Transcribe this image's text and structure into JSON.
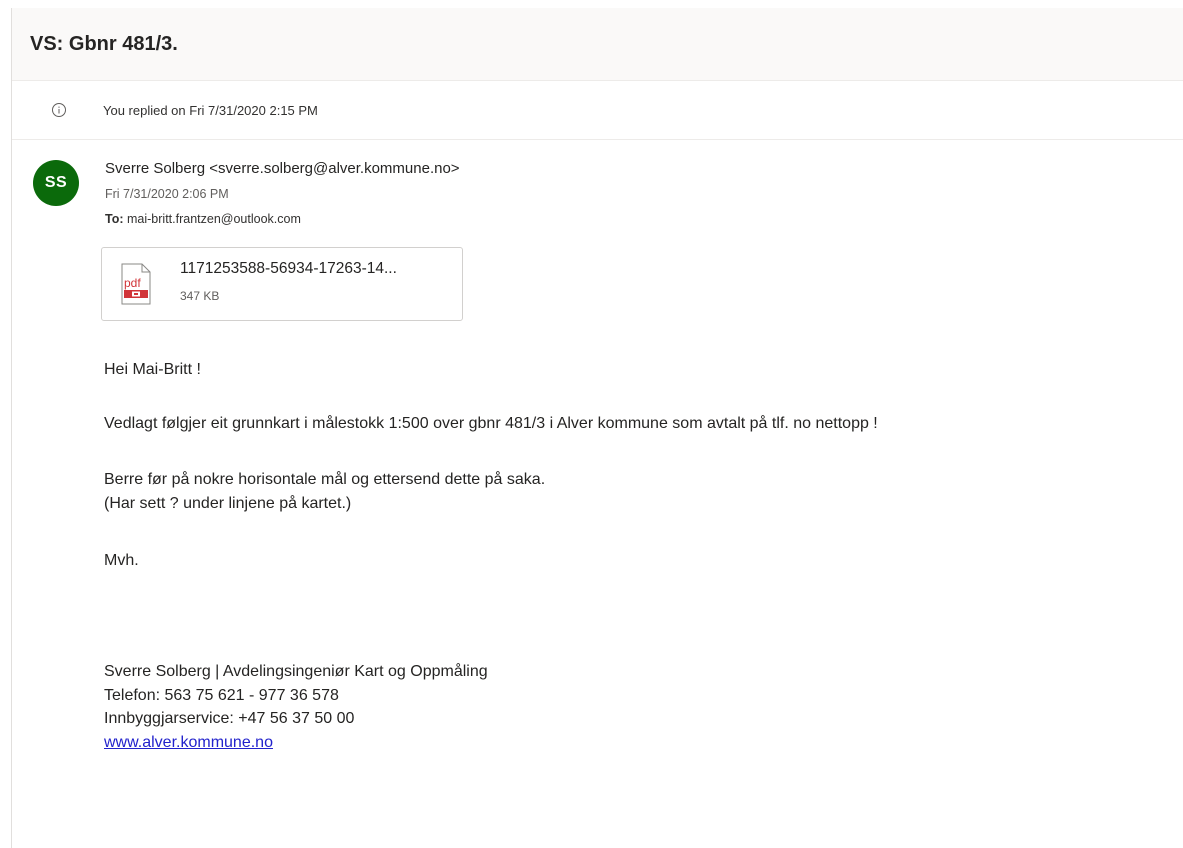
{
  "email": {
    "subject": "VS: Gbnr 481/3.",
    "info_text": "You replied on Fri 7/31/2020 2:15 PM",
    "info_icon": "info-icon",
    "sender": {
      "initials": "SS",
      "avatar_color": "#0b6a0b",
      "line": "Sverre Solberg <sverre.solberg@alver.kommune.no>",
      "date": "Fri 7/31/2020 2:06 PM"
    },
    "recipients": {
      "label": "To:",
      "value": "mai-britt.frantzen@outlook.com"
    },
    "attachment": {
      "icon": "pdf-file-icon",
      "icon_text": "pdf",
      "name": "1171253588-56934-17263-14...",
      "size": "347 KB"
    },
    "body": {
      "greeting": "Hei Mai-Britt !",
      "main": "Vedlagt følgjer eit grunnkart i målestokk 1:500 over gbnr 481/3 i Alver kommune som avtalt på tlf. no nettopp !",
      "line1": "Berre før på nokre horisontale mål og ettersend dette på saka.",
      "line2": "(Har sett ? under linjene på kartet.)",
      "closing": "Mvh."
    },
    "signature": {
      "name_title": "Sverre Solberg | Avdelingsingeniør Kart og Oppmåling",
      "phone": "Telefon: 563 75 621 - 977 36 578",
      "service": "Innbyggjarservice: +47 56 37 50 00",
      "website": "www.alver.kommune.no"
    }
  }
}
